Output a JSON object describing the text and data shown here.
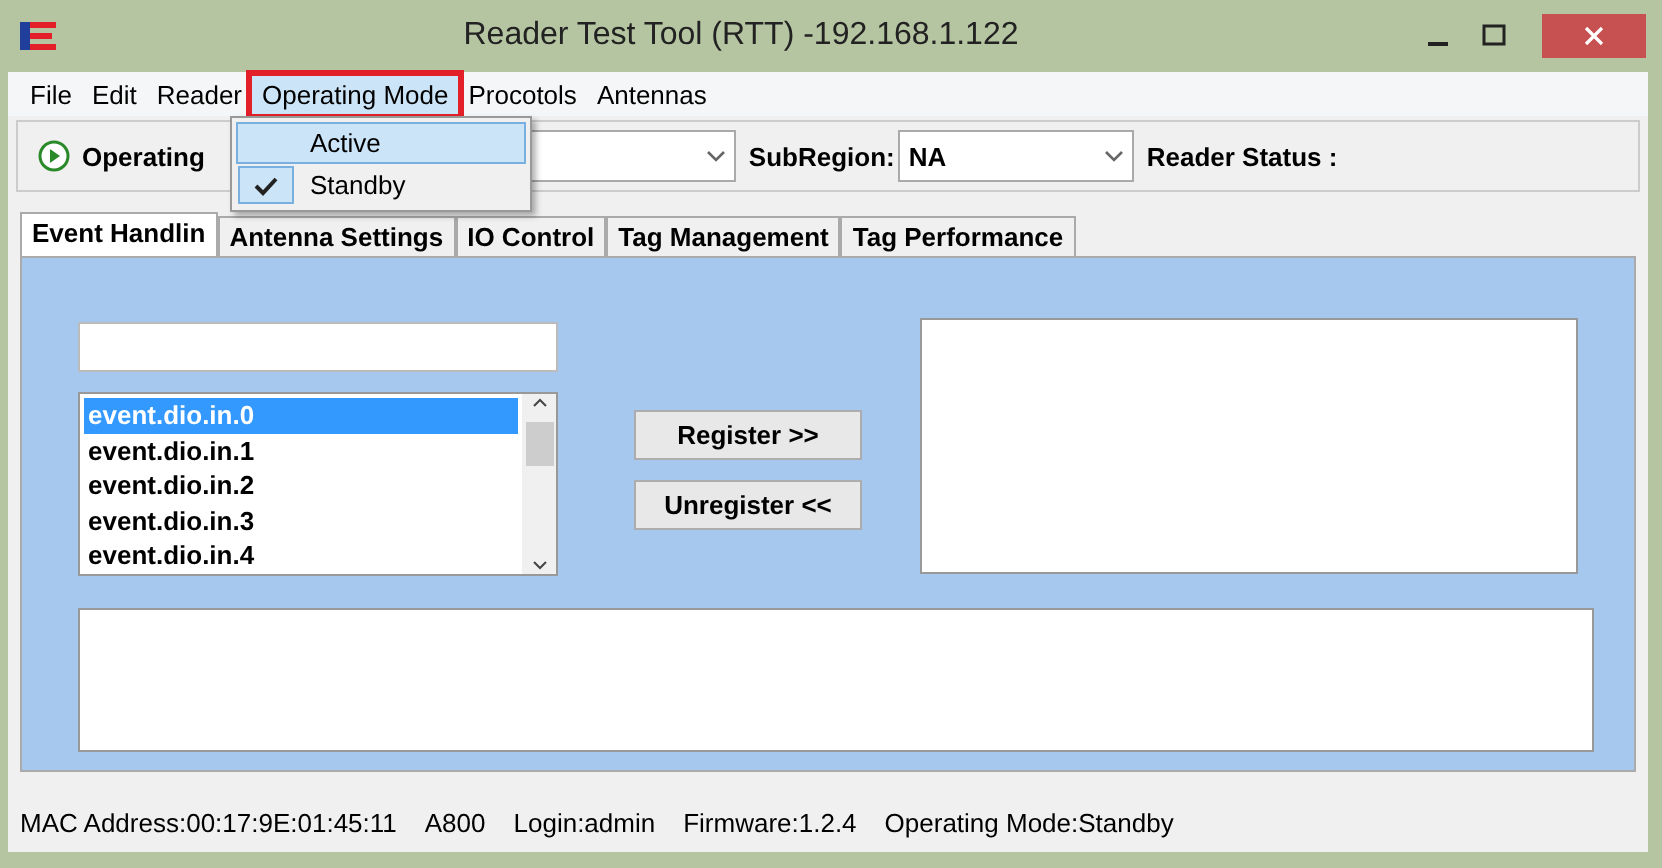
{
  "window": {
    "title": "Reader Test Tool (RTT) -192.168.1.122"
  },
  "menu_bar": [
    {
      "label": "File",
      "open": false,
      "outlined": false
    },
    {
      "label": "Edit",
      "open": false,
      "outlined": false
    },
    {
      "label": "Reader",
      "open": false,
      "outlined": false
    },
    {
      "label": "Operating Mode",
      "open": true,
      "outlined": true
    },
    {
      "label": "Procotols",
      "open": false,
      "outlined": false
    },
    {
      "label": "Antennas",
      "open": false,
      "outlined": false
    }
  ],
  "menu": {
    "items": [
      {
        "label": "Active",
        "checked": false,
        "highlighted": true
      },
      {
        "label": "Standby",
        "checked": true,
        "highlighted": false
      }
    ]
  },
  "toolbar": {
    "operating_label": "Operating",
    "subregion_label": "SubRegion:",
    "subregion_value": "NA",
    "status_label": "Reader Status :"
  },
  "tabs": [
    {
      "label": "Event Handlin",
      "selected": true
    },
    {
      "label": "Antenna Settings",
      "selected": false
    },
    {
      "label": "IO Control",
      "selected": false
    },
    {
      "label": "Tag Management",
      "selected": false
    },
    {
      "label": "Tag Performance",
      "selected": false
    }
  ],
  "events": [
    {
      "label": "event.dio.in.0",
      "selected": true
    },
    {
      "label": "event.dio.in.1",
      "selected": false
    },
    {
      "label": "event.dio.in.2",
      "selected": false
    },
    {
      "label": "event.dio.in.3",
      "selected": false
    },
    {
      "label": "event.dio.in.4",
      "selected": false
    }
  ],
  "buttons": [
    "Register >>",
    "Unregister <<"
  ],
  "status_bar": [
    "MAC Address:00:17:9E:01:45:11",
    "A800",
    "Login:admin",
    "Firmware:1.2.4",
    "Operating Mode:Standby"
  ]
}
